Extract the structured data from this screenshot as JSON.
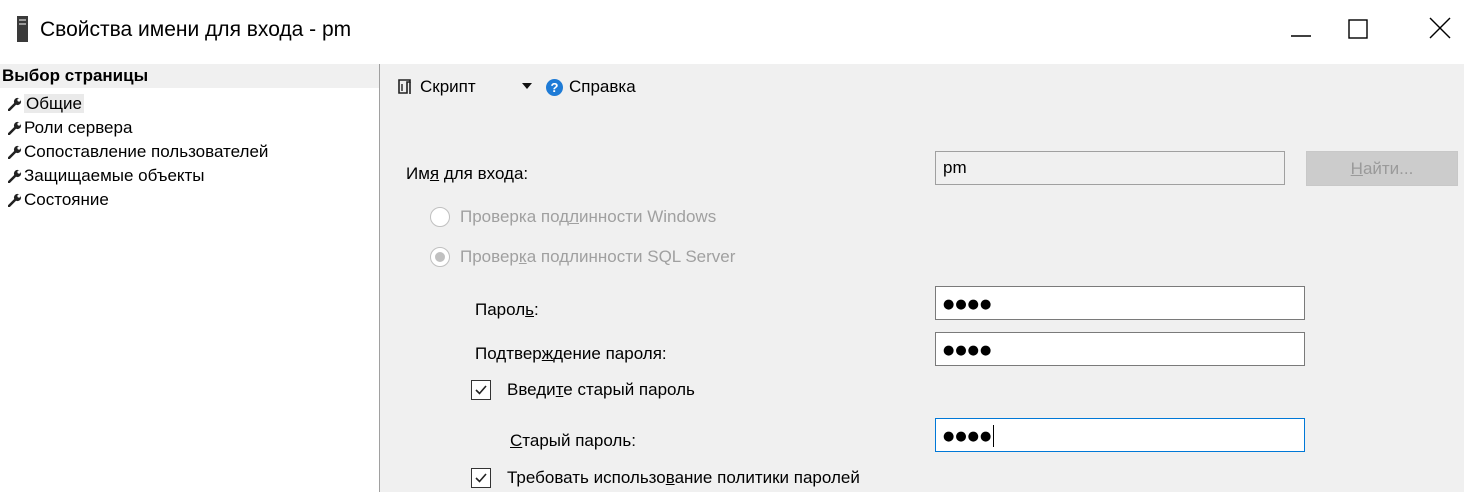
{
  "window": {
    "title": "Свойства имени для входа - pm"
  },
  "nav": {
    "header": "Выбор страницы",
    "items": [
      {
        "label": "Общие",
        "selected": true
      },
      {
        "label": "Роли сервера",
        "selected": false
      },
      {
        "label": "Сопоставление пользователей",
        "selected": false
      },
      {
        "label": "Защищаемые объекты",
        "selected": false
      },
      {
        "label": "Состояние",
        "selected": false
      }
    ]
  },
  "toolbar": {
    "script_label": "Скрипт",
    "help_label": "Справка",
    "icons": [
      "script-icon",
      "dropdown-arrow-icon",
      "help-icon"
    ]
  },
  "form": {
    "login_name": {
      "label_pre": "Им",
      "label_u": "я",
      "label_post": " для входа:",
      "value": "pm"
    },
    "find_button": {
      "u": "Н",
      "rest": "айти..."
    },
    "windows_auth": {
      "pre": "Проверка под",
      "u": "л",
      "post": "инности Windows",
      "checked": false,
      "enabled": false
    },
    "sql_auth": {
      "pre": "Провер",
      "u": "к",
      "post": "а подлинности SQL Server",
      "checked": true,
      "enabled": false
    },
    "password": {
      "pre": "Парол",
      "u": "ь",
      "post": ":",
      "value": "●●●●"
    },
    "confirm_password": {
      "pre": "Подтвер",
      "u": "ж",
      "post": "дение пароля:",
      "value": "●●●●"
    },
    "enter_old_password": {
      "pre": "Введи",
      "u": "т",
      "post": "е старый пароль",
      "checked": true
    },
    "old_password": {
      "u": "С",
      "post": "тарый пароль:",
      "value": "●●●●"
    },
    "enforce_policy": {
      "pre": "Требовать использо",
      "u": "в",
      "post": "ание политики паролей",
      "checked": true
    }
  },
  "colors": {
    "panel_bg": "#f0f0f0",
    "focus_border": "#0078d7",
    "disabled_text": "#a0a0a0",
    "help_icon": "#1e7bd6"
  }
}
